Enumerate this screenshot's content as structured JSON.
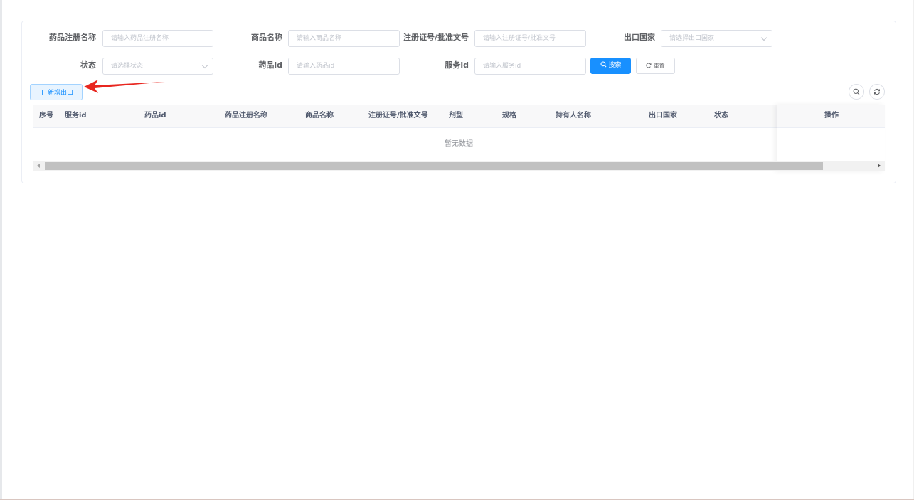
{
  "search_form": {
    "drug_reg_name": {
      "label": "药品注册名称",
      "placeholder": "请输入药品注册名称"
    },
    "product_name": {
      "label": "商品名称",
      "placeholder": "请输入商品名称"
    },
    "reg_cert_no": {
      "label": "注册证号/批准文号",
      "placeholder": "请输入注册证号/批准文号"
    },
    "export_country": {
      "label": "出口国家",
      "placeholder": "请选择出口国家"
    },
    "status": {
      "label": "状态",
      "placeholder": "请选择状态"
    },
    "drug_id": {
      "label": "药品id",
      "placeholder": "请输入药品id"
    },
    "service_id": {
      "label": "服务id",
      "placeholder": "请输入服务id"
    },
    "search_button": "搜索",
    "reset_button": "重置"
  },
  "toolbar": {
    "add_button": "新增出口"
  },
  "table": {
    "columns": [
      "序号",
      "服务id",
      "药品id",
      "药品注册名称",
      "商品名称",
      "注册证号/批准文号",
      "剂型",
      "规格",
      "持有人名称",
      "出口国家",
      "状态"
    ],
    "fixed_column": "操作",
    "empty_text": "暂无数据"
  }
}
